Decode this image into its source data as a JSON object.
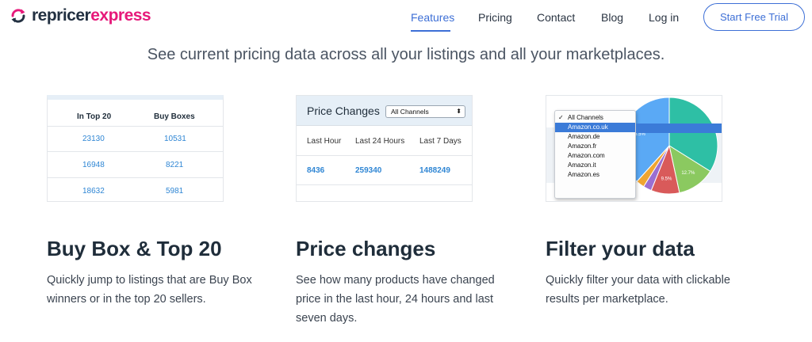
{
  "brand": {
    "name_part1": "repricer",
    "name_part2": "express"
  },
  "nav": {
    "links": [
      "Features",
      "Pricing",
      "Contact",
      "Blog",
      "Log in"
    ],
    "active": "Features",
    "cta": "Start Free Trial"
  },
  "headline": "See current pricing data across all your listings and all your marketplaces.",
  "buybox_panel": {
    "headers": [
      "In Top 20",
      "Buy Boxes"
    ],
    "rows": [
      [
        "23130",
        "10531"
      ],
      [
        "16948",
        "8221"
      ],
      [
        "18632",
        "5981"
      ]
    ]
  },
  "price_panel": {
    "title": "Price Changes",
    "select_value": "All Channels",
    "labels": [
      "Last Hour",
      "Last 24 Hours",
      "Last 7 Days"
    ],
    "values": [
      "8436",
      "259340",
      "1488249"
    ]
  },
  "filter_panel": {
    "options": [
      "All Channels",
      "Amazon.co.uk",
      "Amazon.de",
      "Amazon.fr",
      "Amazon.com",
      "Amazon.it",
      "Amazon.es"
    ],
    "checked": "All Channels",
    "highlighted": "Amazon.co.uk",
    "pie": {
      "slices": [
        {
          "value": 33.9,
          "label": "33.9%",
          "color": "#2ebfa5"
        },
        {
          "value": 12.7,
          "label": "12.7%",
          "color": "#8bc960"
        },
        {
          "value": 9.5,
          "label": "9.5%",
          "color": "#d95a5a"
        },
        {
          "value": 2.8,
          "label": "",
          "color": "#9b6fd1"
        },
        {
          "value": 2.8,
          "label": "",
          "color": "#f0a531"
        },
        {
          "value": 38.3,
          "label": "36.5%",
          "color": "#5aa9f5"
        }
      ]
    }
  },
  "features": [
    {
      "title": "Buy Box & Top 20",
      "desc": [
        "Quickly jump to listings that are Buy Box",
        "winners or in the top 20 sellers."
      ]
    },
    {
      "title": "Price changes",
      "desc": [
        "See how many products have changed",
        "price in the last hour, 24 hours and last",
        "seven days."
      ]
    },
    {
      "title": "Filter your data",
      "desc": [
        "Quickly filter your data with clickable",
        "results per marketplace."
      ]
    }
  ]
}
